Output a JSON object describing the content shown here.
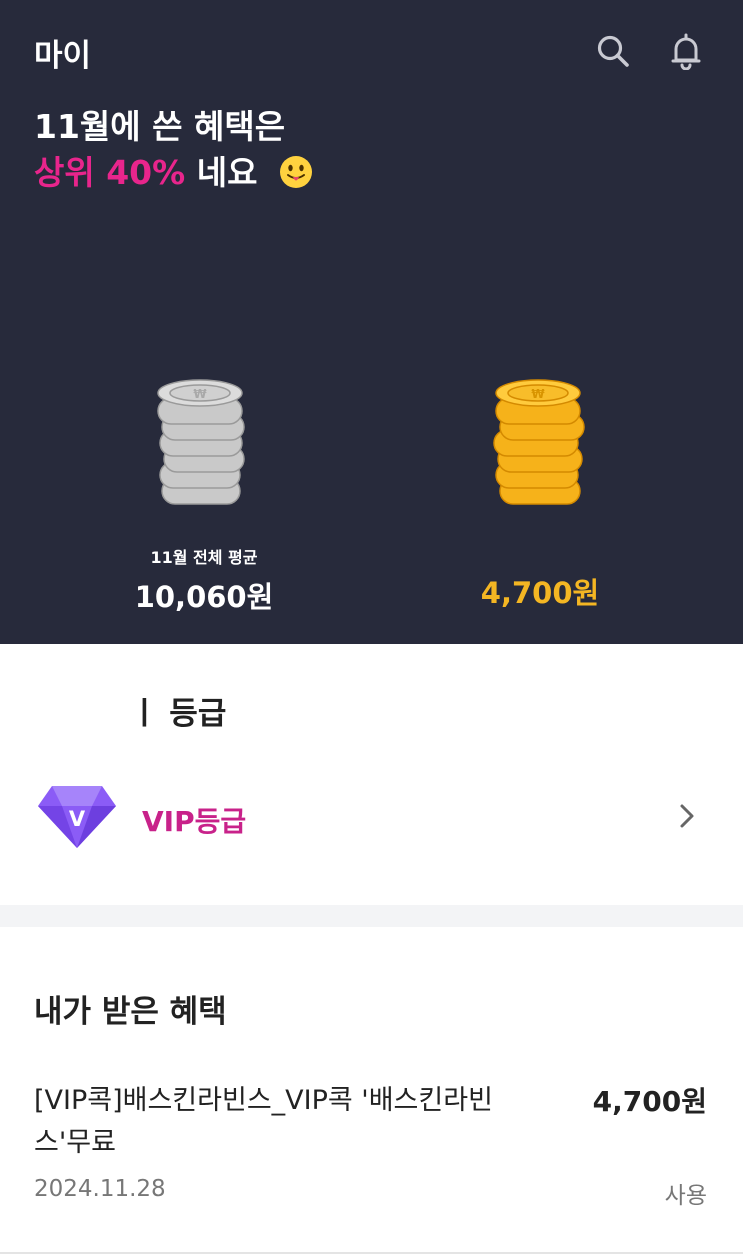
{
  "header": {
    "title": "마이",
    "search_icon": "search-icon",
    "bell_icon": "bell-icon"
  },
  "summary": {
    "line1": "11월에 쓴 혜택은",
    "line2_accent": "상위 40%",
    "line2_rest": "네요",
    "emoji": "smiling-face-with-tongue"
  },
  "comparison": {
    "average_label": "11월 전체 평균",
    "average_value": "10,060원",
    "my_value": "4,700원"
  },
  "grade": {
    "section_title": "ㅣ 등급",
    "name": "VIP등급",
    "badge_letter": "V"
  },
  "benefits": {
    "section_title": "내가 받은 혜택",
    "items": [
      {
        "name": "[VIP콕]배스킨라빈스_VIP콕 '배스킨라빈스'무료",
        "amount": "4,700원",
        "date": "2024.11.28",
        "status": "사용"
      }
    ]
  },
  "colors": {
    "hero_bg": "#272a3b",
    "accent_pink": "#e8258c",
    "gold": "#f4b623",
    "grade_purple": "#8b5cf6",
    "grade_text": "#c8228a"
  }
}
